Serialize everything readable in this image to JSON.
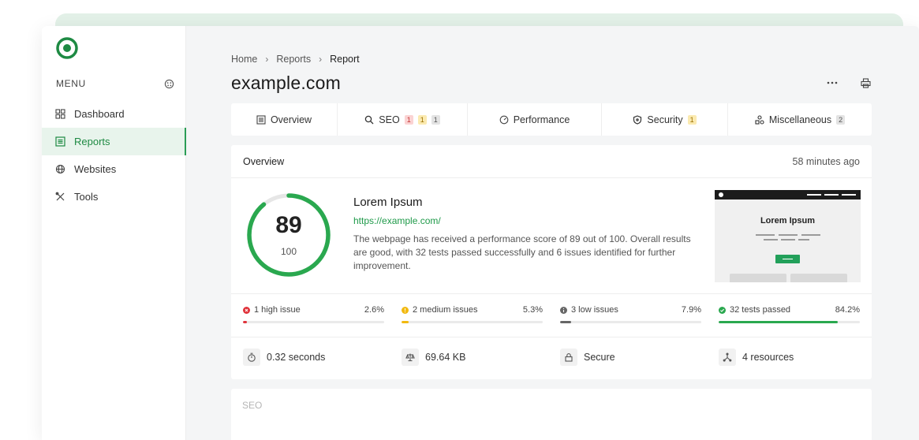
{
  "sidebar": {
    "menu_label": "MENU",
    "items": [
      {
        "label": "Dashboard",
        "icon": "grid-icon"
      },
      {
        "label": "Reports",
        "icon": "report-icon",
        "active": true
      },
      {
        "label": "Websites",
        "icon": "globe-icon"
      },
      {
        "label": "Tools",
        "icon": "tools-icon"
      }
    ]
  },
  "breadcrumb": [
    "Home",
    "Reports",
    "Report"
  ],
  "page": {
    "title": "example.com"
  },
  "tabs": [
    {
      "label": "Overview",
      "icon": "list-icon",
      "badges": []
    },
    {
      "label": "SEO",
      "icon": "search-icon",
      "badges": [
        "1",
        "1",
        "1"
      ]
    },
    {
      "label": "Performance",
      "icon": "gauge-icon",
      "badges": []
    },
    {
      "label": "Security",
      "icon": "shield-icon",
      "badges": [
        "1"
      ]
    },
    {
      "label": "Miscellaneous",
      "icon": "shapes-icon",
      "badges": [
        "2"
      ]
    }
  ],
  "overview": {
    "title": "Overview",
    "time_ago": "58 minutes ago",
    "score": "89",
    "score_max": "100",
    "score_fraction": 0.89,
    "site_title": "Lorem Ipsum",
    "site_url": "https://example.com/",
    "description": "The webpage has received a performance score of 89 out of 100. Overall results are good, with 32 tests passed successfully and 6 issues identified for further improvement.",
    "preview_title": "Lorem Ipsum"
  },
  "stats": [
    {
      "label": "1 high issue",
      "percent": "2.6%",
      "value": 2.6,
      "color": "#e0333b"
    },
    {
      "label": "2 medium issues",
      "percent": "5.3%",
      "value": 5.3,
      "color": "#f2b90f"
    },
    {
      "label": "3 low issues",
      "percent": "7.9%",
      "value": 7.9,
      "color": "#666666"
    },
    {
      "label": "32 tests passed",
      "percent": "84.2%",
      "value": 84.2,
      "color": "#2aa84f"
    }
  ],
  "metrics": [
    {
      "label": "0.32 seconds",
      "icon": "stopwatch-icon"
    },
    {
      "label": "69.64 KB",
      "icon": "scale-icon"
    },
    {
      "label": "Secure",
      "icon": "lock-icon"
    },
    {
      "label": "4 resources",
      "icon": "nodes-icon"
    }
  ],
  "seo_section": {
    "title": "SEO"
  },
  "colors": {
    "accent": "#2aa84f",
    "accent_text": "#1f9a4a"
  }
}
